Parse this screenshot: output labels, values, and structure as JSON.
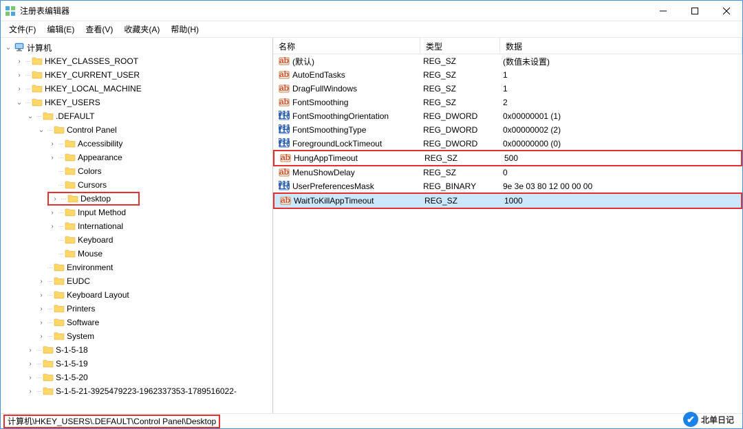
{
  "window": {
    "title": "注册表编辑器"
  },
  "menu": {
    "file": "文件(F)",
    "edit": "编辑(E)",
    "view": "查看(V)",
    "favorites": "收藏夹(A)",
    "help": "帮助(H)"
  },
  "tree": {
    "root": "计算机",
    "hkcr": "HKEY_CLASSES_ROOT",
    "hkcu": "HKEY_CURRENT_USER",
    "hklm": "HKEY_LOCAL_MACHINE",
    "hku": "HKEY_USERS",
    "default": ".DEFAULT",
    "control_panel": "Control Panel",
    "cp_children": {
      "accessibility": "Accessibility",
      "appearance": "Appearance",
      "colors": "Colors",
      "cursors": "Cursors",
      "desktop": "Desktop",
      "input_method": "Input Method",
      "international": "International",
      "keyboard": "Keyboard",
      "mouse": "Mouse"
    },
    "default_siblings": {
      "environment": "Environment",
      "eudc": "EUDC",
      "keyboard_layout": "Keyboard Layout",
      "printers": "Printers",
      "software": "Software",
      "system": "System"
    },
    "sids": {
      "s18": "S-1-5-18",
      "s19": "S-1-5-19",
      "s20": "S-1-5-20",
      "s21": "S-1-5-21-3925479223-1962337353-1789516022-"
    }
  },
  "columns": {
    "name": "名称",
    "type": "类型",
    "data": "数据"
  },
  "values": [
    {
      "icon": "sz",
      "name": "(默认)",
      "type": "REG_SZ",
      "data": "(数值未设置)",
      "highlight": false,
      "selected": false
    },
    {
      "icon": "sz",
      "name": "AutoEndTasks",
      "type": "REG_SZ",
      "data": "1",
      "highlight": false,
      "selected": false
    },
    {
      "icon": "sz",
      "name": "DragFullWindows",
      "type": "REG_SZ",
      "data": "1",
      "highlight": false,
      "selected": false
    },
    {
      "icon": "sz",
      "name": "FontSmoothing",
      "type": "REG_SZ",
      "data": "2",
      "highlight": false,
      "selected": false
    },
    {
      "icon": "bin",
      "name": "FontSmoothingOrientation",
      "type": "REG_DWORD",
      "data": "0x00000001 (1)",
      "highlight": false,
      "selected": false
    },
    {
      "icon": "bin",
      "name": "FontSmoothingType",
      "type": "REG_DWORD",
      "data": "0x00000002 (2)",
      "highlight": false,
      "selected": false
    },
    {
      "icon": "bin",
      "name": "ForegroundLockTimeout",
      "type": "REG_DWORD",
      "data": "0x00000000 (0)",
      "highlight": false,
      "selected": false
    },
    {
      "icon": "sz",
      "name": "HungAppTimeout",
      "type": "REG_SZ",
      "data": "500",
      "highlight": true,
      "selected": false
    },
    {
      "icon": "sz",
      "name": "MenuShowDelay",
      "type": "REG_SZ",
      "data": "0",
      "highlight": false,
      "selected": false
    },
    {
      "icon": "bin",
      "name": "UserPreferencesMask",
      "type": "REG_BINARY",
      "data": "9e 3e 03 80 12 00 00 00",
      "highlight": false,
      "selected": false
    },
    {
      "icon": "sz",
      "name": "WaitToKillAppTimeout",
      "type": "REG_SZ",
      "data": "1000",
      "highlight": true,
      "selected": true
    }
  ],
  "statusbar": {
    "path": "计算机\\HKEY_USERS\\.DEFAULT\\Control Panel\\Desktop"
  },
  "watermark": "北单日记"
}
